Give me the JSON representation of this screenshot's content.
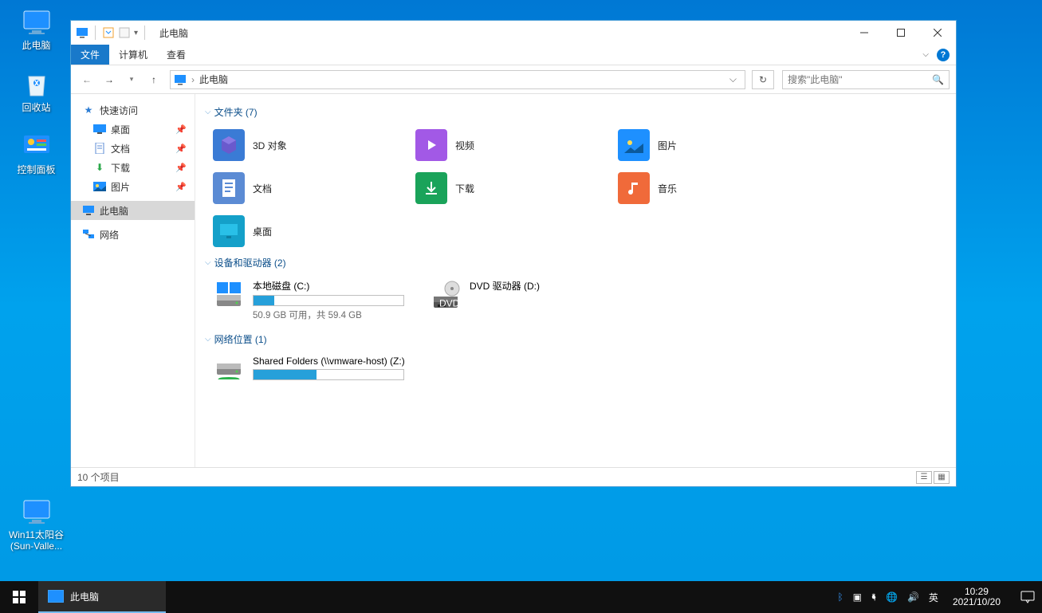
{
  "desktop": {
    "icons": [
      {
        "label": "此电脑",
        "name": "this-pc"
      },
      {
        "label": "回收站",
        "name": "recycle-bin"
      },
      {
        "label": "控制面板",
        "name": "control-panel"
      },
      {
        "label": "Win11太阳谷(Sun-Valle...",
        "name": "win11-sunvalley"
      }
    ]
  },
  "window": {
    "title": "此电脑",
    "menus": {
      "file": "文件",
      "computer": "计算机",
      "view": "查看"
    },
    "address": {
      "crumb": "此电脑"
    },
    "search": {
      "placeholder": "搜索\"此电脑\""
    },
    "sidebar": {
      "quick": "快速访问",
      "desktop": "桌面",
      "documents": "文档",
      "downloads": "下载",
      "pictures": "图片",
      "thispc": "此电脑",
      "network": "网络"
    },
    "sections": {
      "folders": "文件夹 (7)",
      "devices": "设备和驱动器 (2)",
      "netloc": "网络位置 (1)"
    },
    "folders": {
      "objects3d": "3D 对象",
      "videos": "视频",
      "pictures": "图片",
      "documents": "文档",
      "downloads": "下载",
      "music": "音乐",
      "desktop": "桌面"
    },
    "drives": {
      "c": {
        "label": "本地磁盘 (C:)",
        "free": "50.9 GB 可用，共 59.4 GB",
        "fill_pct": 14
      },
      "d": {
        "label": "DVD 驱动器 (D:)"
      }
    },
    "netloc": {
      "shared": {
        "label": "Shared Folders (\\\\vmware-host) (Z:)",
        "fill_pct": 42
      }
    },
    "status": "10 个项目"
  },
  "taskbar": {
    "active": "此电脑",
    "ime": "英",
    "time": "10:29",
    "date": "2021/10/20"
  }
}
